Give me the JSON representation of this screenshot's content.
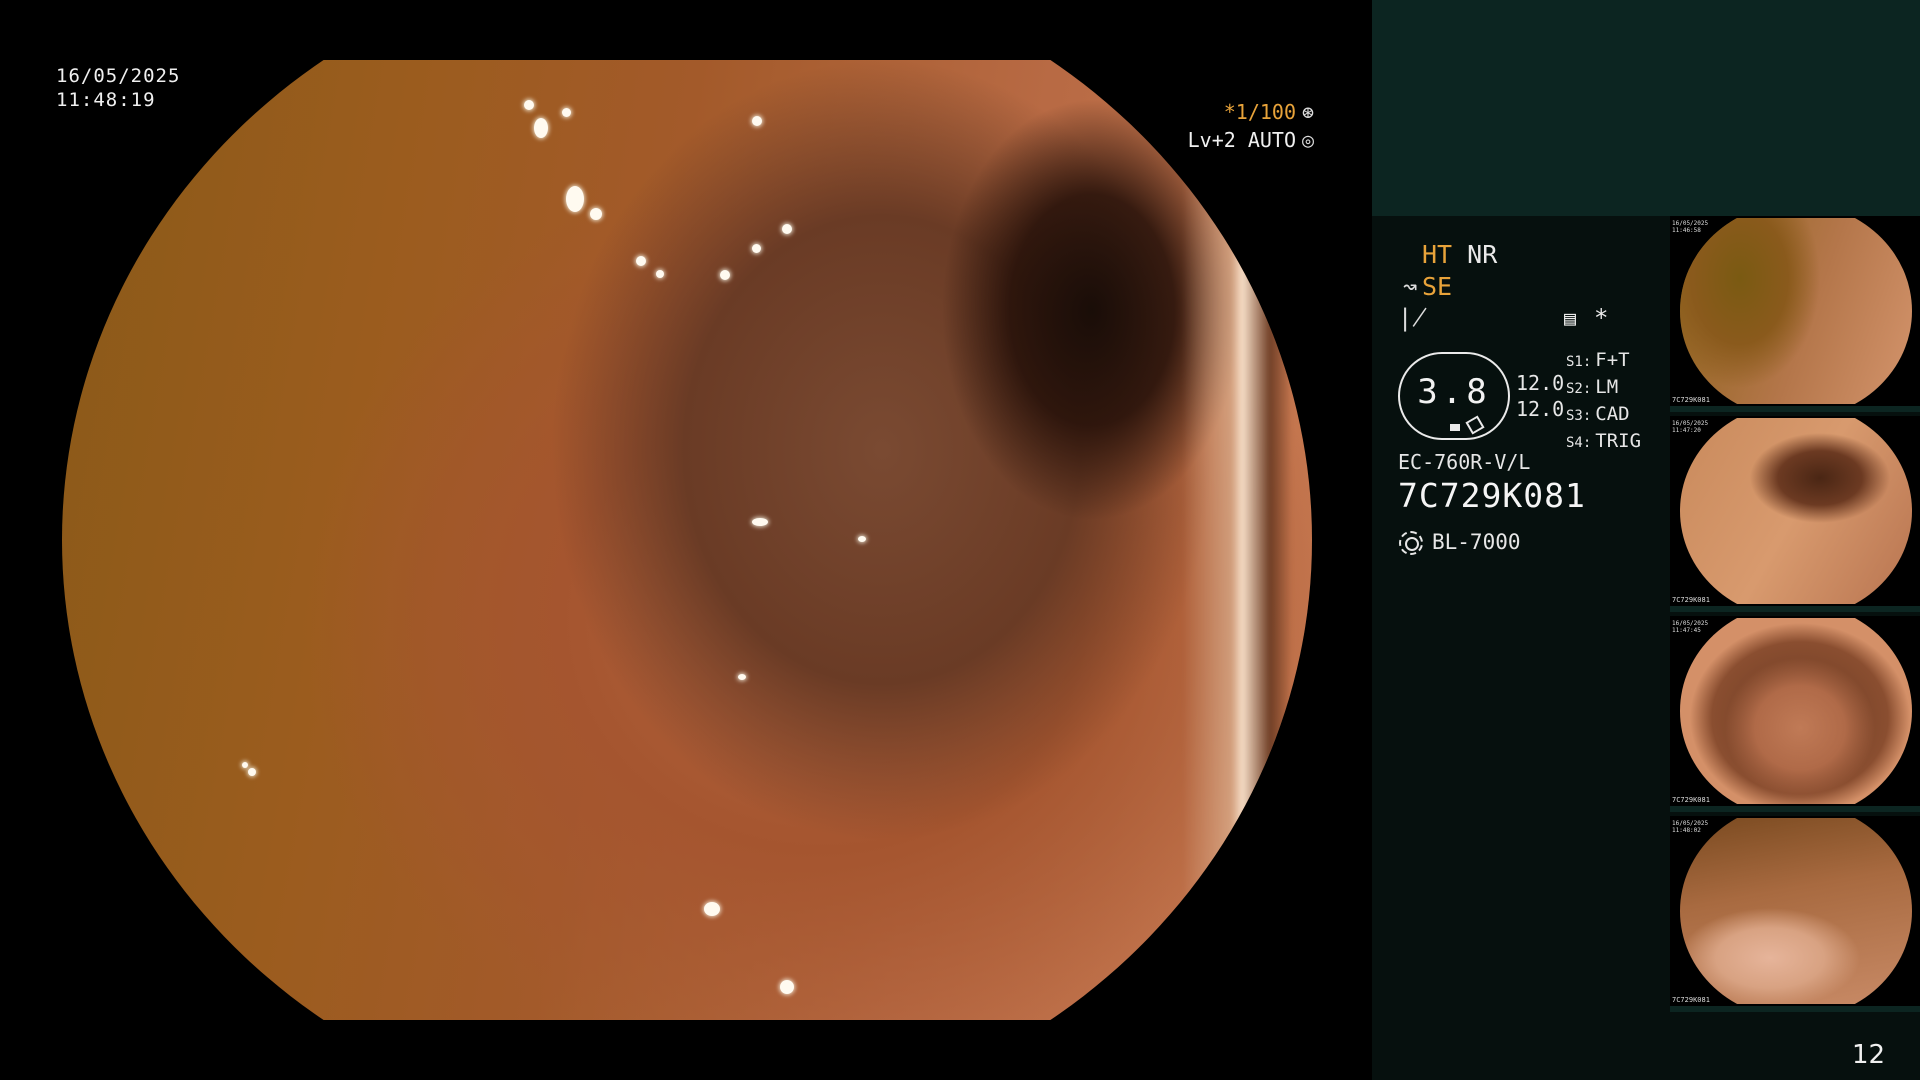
{
  "overlay": {
    "date": "16/05/2025",
    "time": "11:48:19",
    "shutter_line": "*1/100",
    "shutter_icon": "aperture-icon",
    "iris_line": "Lv+2 AUTO",
    "iris_icon": "iris-ring-icon"
  },
  "panel": {
    "ht": "HT",
    "nr": "NR",
    "enhancement": "SE",
    "enhancement_icon": "enhancement-curve-icon",
    "gamma_icon": "gamma-curve-icon",
    "monitor_icon": "monitor-settings-icon",
    "asterisk": "*",
    "gauge_value": "3.8",
    "levels": [
      "12.0",
      "12.0"
    ],
    "settings": [
      {
        "key": "S1:",
        "value": "F+T"
      },
      {
        "key": "S2:",
        "value": "LM"
      },
      {
        "key": "S3:",
        "value": "CAD"
      },
      {
        "key": "S4:",
        "value": "TRIG"
      }
    ],
    "scope_model": "EC-760R-V/L",
    "scope_serial": "7C729K081",
    "light_source": "BL-7000",
    "light_icon": "light-source-icon"
  },
  "thumbnails": [
    {
      "date": "16/05/2025",
      "time": "11:46:58",
      "serial": "7C729K081"
    },
    {
      "date": "16/05/2025",
      "time": "11:47:20",
      "serial": "7C729K081"
    },
    {
      "date": "16/05/2025",
      "time": "11:47:45",
      "serial": "7C729K081"
    },
    {
      "date": "16/05/2025",
      "time": "11:48:02",
      "serial": "7C729K081"
    }
  ],
  "page_number": "12",
  "colors": {
    "accent_amber": "#e8a33a",
    "panel_background": "#06100e",
    "panel_header": "#0c2521"
  }
}
